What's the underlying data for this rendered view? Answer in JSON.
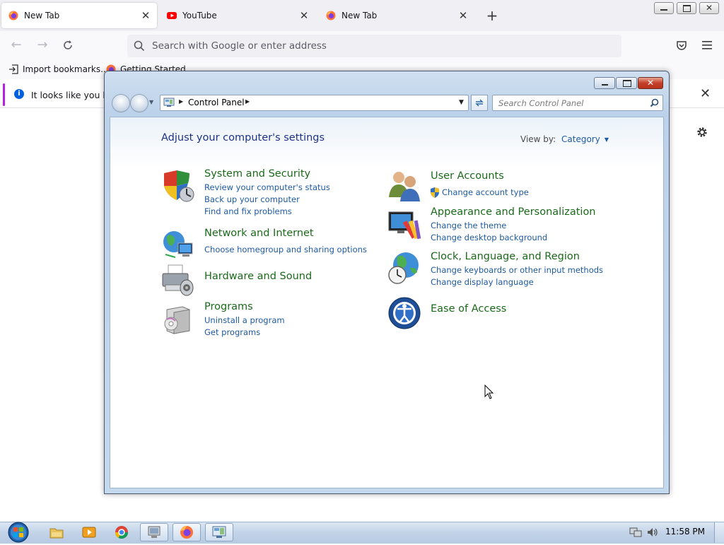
{
  "browser": {
    "tabs": [
      {
        "label": "New Tab",
        "active": true,
        "icon": "firefox-icon"
      },
      {
        "label": "YouTube",
        "active": false,
        "icon": "youtube-icon"
      },
      {
        "label": "New Tab",
        "active": false,
        "icon": "firefox-icon"
      }
    ],
    "address_placeholder": "Search with Google or enter address",
    "bookmarks": [
      {
        "label": "Import bookmarks...",
        "icon": "import-icon"
      },
      {
        "label": "Getting Started",
        "icon": "firefox-icon"
      }
    ],
    "notification_text": "It looks like you hav"
  },
  "control_panel": {
    "breadcrumb": "Control Panel",
    "search_placeholder": "Search Control Panel",
    "heading": "Adjust your computer's settings",
    "view_by_label": "View by:",
    "view_by_value": "Category",
    "categories_left": [
      {
        "title": "System and Security",
        "icon": "shield-icon",
        "links": [
          "Review your computer's status",
          "Back up your computer",
          "Find and fix problems"
        ]
      },
      {
        "title": "Network and Internet",
        "icon": "network-globe-icon",
        "links": [
          "Choose homegroup and sharing options"
        ]
      },
      {
        "title": "Hardware and Sound",
        "icon": "printer-icon",
        "links": []
      },
      {
        "title": "Programs",
        "icon": "programs-box-icon",
        "links": [
          "Uninstall a program",
          "Get programs"
        ]
      }
    ],
    "categories_right": [
      {
        "title": "User Accounts",
        "icon": "users-icon",
        "links": [
          "Change account type"
        ]
      },
      {
        "title": "Appearance and Personalization",
        "icon": "monitor-paint-icon",
        "links": [
          "Change the theme",
          "Change desktop background"
        ]
      },
      {
        "title": "Clock, Language, and Region",
        "icon": "globe-clock-icon",
        "links": [
          "Change keyboards or other input methods",
          "Change display language"
        ]
      },
      {
        "title": "Ease of Access",
        "icon": "ease-of-access-icon",
        "links": []
      }
    ]
  },
  "taskbar": {
    "items": [
      "start-orb-icon",
      "file-explorer-icon",
      "media-player-icon",
      "chrome-icon",
      "computer-icon",
      "firefox-icon",
      "control-panel-icon"
    ],
    "clock": "11:58 PM"
  }
}
